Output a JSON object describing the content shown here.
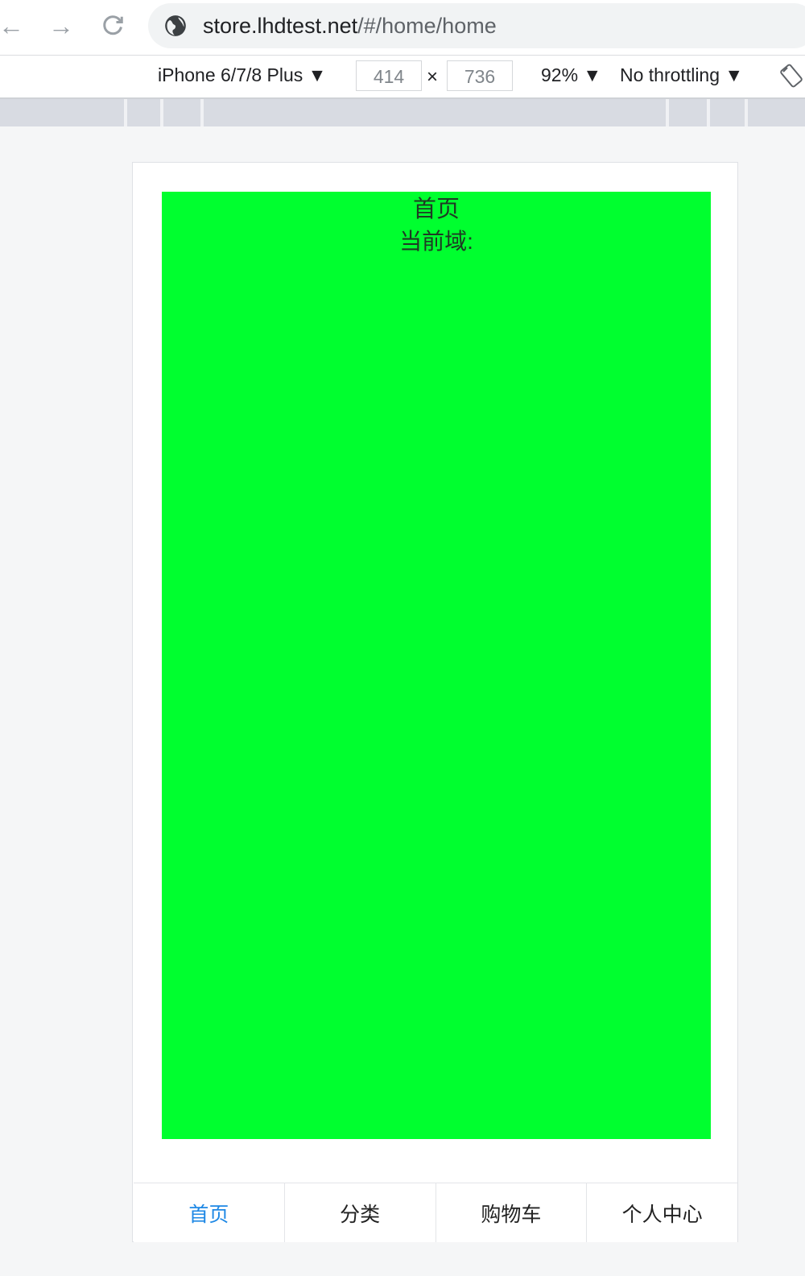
{
  "browser": {
    "url_host": "store.lhdtest.net",
    "url_path": "/#/home/home",
    "icons": {
      "back": "arrow-left-icon",
      "forward": "arrow-right-icon",
      "reload": "reload-icon",
      "site_info": "globe-icon"
    }
  },
  "device_toolbar": {
    "device": "iPhone 6/7/8 Plus ▼",
    "width": "414",
    "separator": "×",
    "height": "736",
    "zoom": "92% ▼",
    "throttling": "No throttling ▼",
    "rotate_icon": "rotate-icon"
  },
  "page": {
    "title": "首页",
    "domain_label": "当前域:",
    "panel_color": "#00ff2f"
  },
  "tabbar": {
    "active_color": "#1e88e5",
    "tabs": [
      {
        "label": "首页"
      },
      {
        "label": "分类"
      },
      {
        "label": "购物车"
      },
      {
        "label": "个人中心"
      }
    ]
  }
}
